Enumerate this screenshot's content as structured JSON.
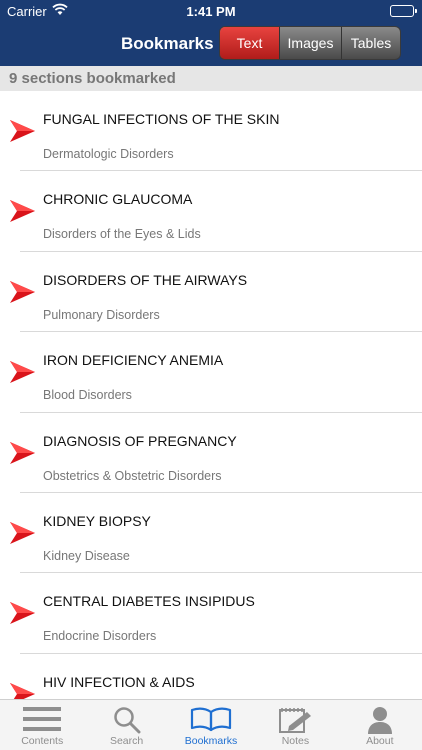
{
  "status_bar": {
    "carrier": "Carrier",
    "time": "1:41 PM"
  },
  "nav": {
    "title": "Bookmarks",
    "segments": [
      {
        "label": "Text",
        "active": true
      },
      {
        "label": "Images",
        "active": false
      },
      {
        "label": "Tables",
        "active": false
      }
    ]
  },
  "section_header": "9 sections bookmarked",
  "bookmarks": [
    {
      "title": "FUNGAL INFECTIONS OF THE SKIN",
      "subtitle": "Dermatologic Disorders"
    },
    {
      "title": "CHRONIC GLAUCOMA",
      "subtitle": "Disorders of the Eyes & Lids"
    },
    {
      "title": "DISORDERS OF THE AIRWAYS",
      "subtitle": "Pulmonary Disorders"
    },
    {
      "title": "IRON DEFICIENCY ANEMIA",
      "subtitle": "Blood Disorders"
    },
    {
      "title": "DIAGNOSIS OF PREGNANCY",
      "subtitle": "Obstetrics & Obstetric Disorders"
    },
    {
      "title": "KIDNEY BIOPSY",
      "subtitle": "Kidney Disease"
    },
    {
      "title": "CENTRAL DIABETES INSIPIDUS",
      "subtitle": "Endocrine Disorders"
    },
    {
      "title": "HIV INFECTION & AIDS",
      "subtitle": ""
    }
  ],
  "tabs": [
    {
      "label": "Contents",
      "icon": "list-icon",
      "active": false
    },
    {
      "label": "Search",
      "icon": "search-icon",
      "active": false
    },
    {
      "label": "Bookmarks",
      "icon": "open-book-icon",
      "active": true
    },
    {
      "label": "Notes",
      "icon": "notepad-pencil-icon",
      "active": false
    },
    {
      "label": "About",
      "icon": "person-icon",
      "active": false
    }
  ],
  "colors": {
    "nav_background": "#1b3c73",
    "segment_active": "#c9302c",
    "arrow_red": "#d9141b",
    "tab_active": "#1f6fd1",
    "tab_inactive": "#8e8e8e"
  }
}
